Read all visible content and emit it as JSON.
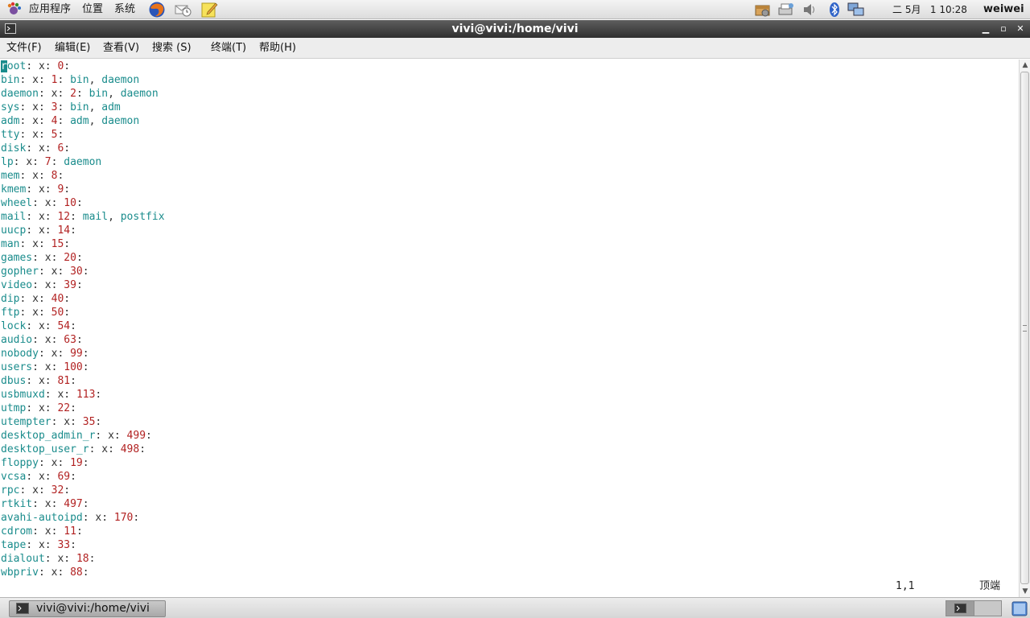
{
  "top_panel": {
    "menus": [
      "应用程序",
      "位置",
      "系统"
    ],
    "clock": "二 5月   1 10:28",
    "username": "weiwei",
    "app_icons": [
      "gnome-foot-icon",
      "firefox-icon",
      "mail-clock-icon",
      "notes-icon"
    ],
    "tray_icons": [
      "update-icon",
      "network-printer-icon",
      "volume-icon",
      "bluetooth-icon",
      "network-icon"
    ]
  },
  "window": {
    "title": "vivi@vivi:/home/vivi",
    "buttons": [
      "minimize",
      "maximize",
      "close"
    ]
  },
  "menubar": {
    "items": [
      "文件(F)",
      "编辑(E)",
      "查看(V)",
      "搜索 (S)",
      "终端(T)",
      "帮助(H)"
    ]
  },
  "terminal": {
    "lines": [
      {
        "name": "root",
        "gid": "0",
        "members": []
      },
      {
        "name": "bin",
        "gid": "1",
        "members": [
          "bin",
          "daemon"
        ]
      },
      {
        "name": "daemon",
        "gid": "2",
        "members": [
          "bin",
          "daemon"
        ]
      },
      {
        "name": "sys",
        "gid": "3",
        "members": [
          "bin",
          "adm"
        ]
      },
      {
        "name": "adm",
        "gid": "4",
        "members": [
          "adm",
          "daemon"
        ]
      },
      {
        "name": "tty",
        "gid": "5",
        "members": []
      },
      {
        "name": "disk",
        "gid": "6",
        "members": []
      },
      {
        "name": "lp",
        "gid": "7",
        "members": [
          "daemon"
        ]
      },
      {
        "name": "mem",
        "gid": "8",
        "members": []
      },
      {
        "name": "kmem",
        "gid": "9",
        "members": []
      },
      {
        "name": "wheel",
        "gid": "10",
        "members": []
      },
      {
        "name": "mail",
        "gid": "12",
        "members": [
          "mail",
          "postfix"
        ]
      },
      {
        "name": "uucp",
        "gid": "14",
        "members": []
      },
      {
        "name": "man",
        "gid": "15",
        "members": []
      },
      {
        "name": "games",
        "gid": "20",
        "members": []
      },
      {
        "name": "gopher",
        "gid": "30",
        "members": []
      },
      {
        "name": "video",
        "gid": "39",
        "members": []
      },
      {
        "name": "dip",
        "gid": "40",
        "members": []
      },
      {
        "name": "ftp",
        "gid": "50",
        "members": []
      },
      {
        "name": "lock",
        "gid": "54",
        "members": []
      },
      {
        "name": "audio",
        "gid": "63",
        "members": []
      },
      {
        "name": "nobody",
        "gid": "99",
        "members": []
      },
      {
        "name": "users",
        "gid": "100",
        "members": []
      },
      {
        "name": "dbus",
        "gid": "81",
        "members": []
      },
      {
        "name": "usbmuxd",
        "gid": "113",
        "members": []
      },
      {
        "name": "utmp",
        "gid": "22",
        "members": []
      },
      {
        "name": "utempter",
        "gid": "35",
        "members": []
      },
      {
        "name": "desktop_admin_r",
        "gid": "499",
        "members": []
      },
      {
        "name": "desktop_user_r",
        "gid": "498",
        "members": []
      },
      {
        "name": "floppy",
        "gid": "19",
        "members": []
      },
      {
        "name": "vcsa",
        "gid": "69",
        "members": []
      },
      {
        "name": "rpc",
        "gid": "32",
        "members": []
      },
      {
        "name": "rtkit",
        "gid": "497",
        "members": []
      },
      {
        "name": "avahi-autoipd",
        "gid": "170",
        "members": []
      },
      {
        "name": "cdrom",
        "gid": "11",
        "members": []
      },
      {
        "name": "tape",
        "gid": "33",
        "members": []
      },
      {
        "name": "dialout",
        "gid": "18",
        "members": []
      },
      {
        "name": "wbpriv",
        "gid": "88",
        "members": []
      }
    ],
    "status_position": "1,1",
    "status_top": "顶端"
  },
  "taskbar": {
    "task_label": "vivi@vivi:/home/vivi"
  },
  "colors": {
    "name": "#1a8c8c",
    "gid": "#b22222",
    "separator": "#333333"
  }
}
